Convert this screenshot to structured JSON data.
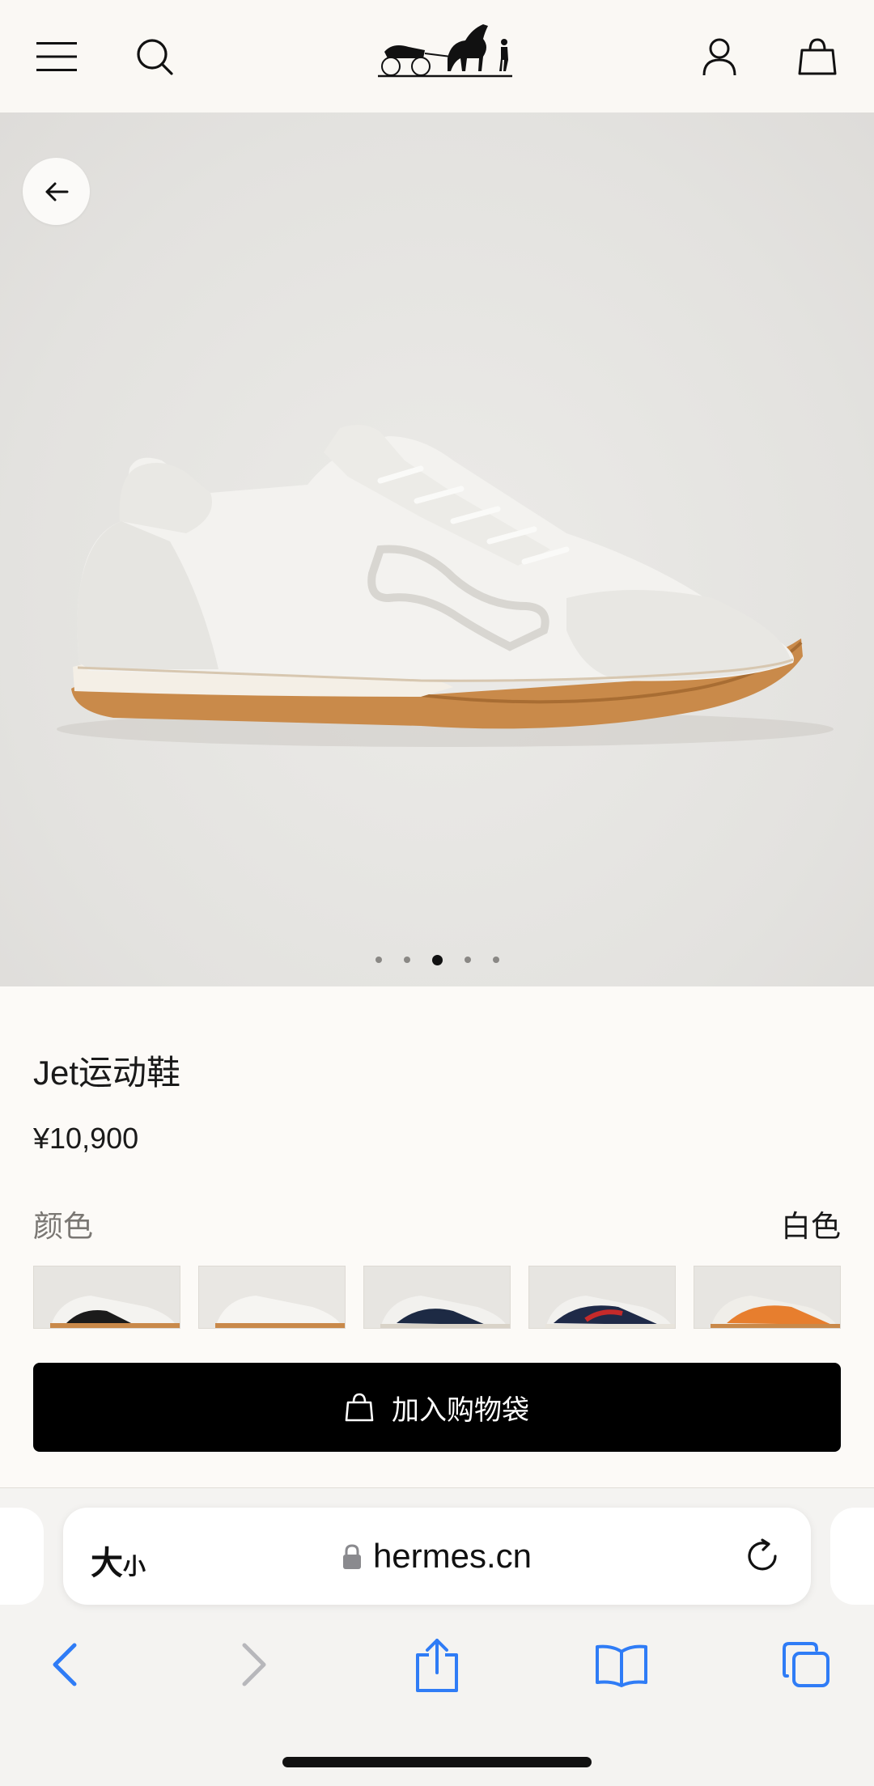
{
  "header": {
    "icons": [
      "menu-icon",
      "search-icon",
      "account-icon",
      "shopping-bag-icon"
    ],
    "logo": "hermes-logo"
  },
  "gallery": {
    "dot_count": 5,
    "active_dot_index": 2
  },
  "product": {
    "title": "Jet运动鞋",
    "price": "¥10,900",
    "color_label": "颜色",
    "color_value": "白色",
    "swatch_colors": [
      "black-white",
      "white",
      "navy",
      "red-navy",
      "orange"
    ]
  },
  "cta": {
    "add_to_bag": "加入购物袋"
  },
  "browser": {
    "text_size_big": "大",
    "text_size_small": "小",
    "url": "hermes.cn",
    "toolbar_icons": [
      "back-icon",
      "forward-icon",
      "share-icon",
      "bookmarks-icon",
      "tabs-icon"
    ]
  },
  "colors": {
    "accent_blue": "#2f7cf6",
    "background": "#fcfaf7",
    "cta_black": "#000000"
  }
}
